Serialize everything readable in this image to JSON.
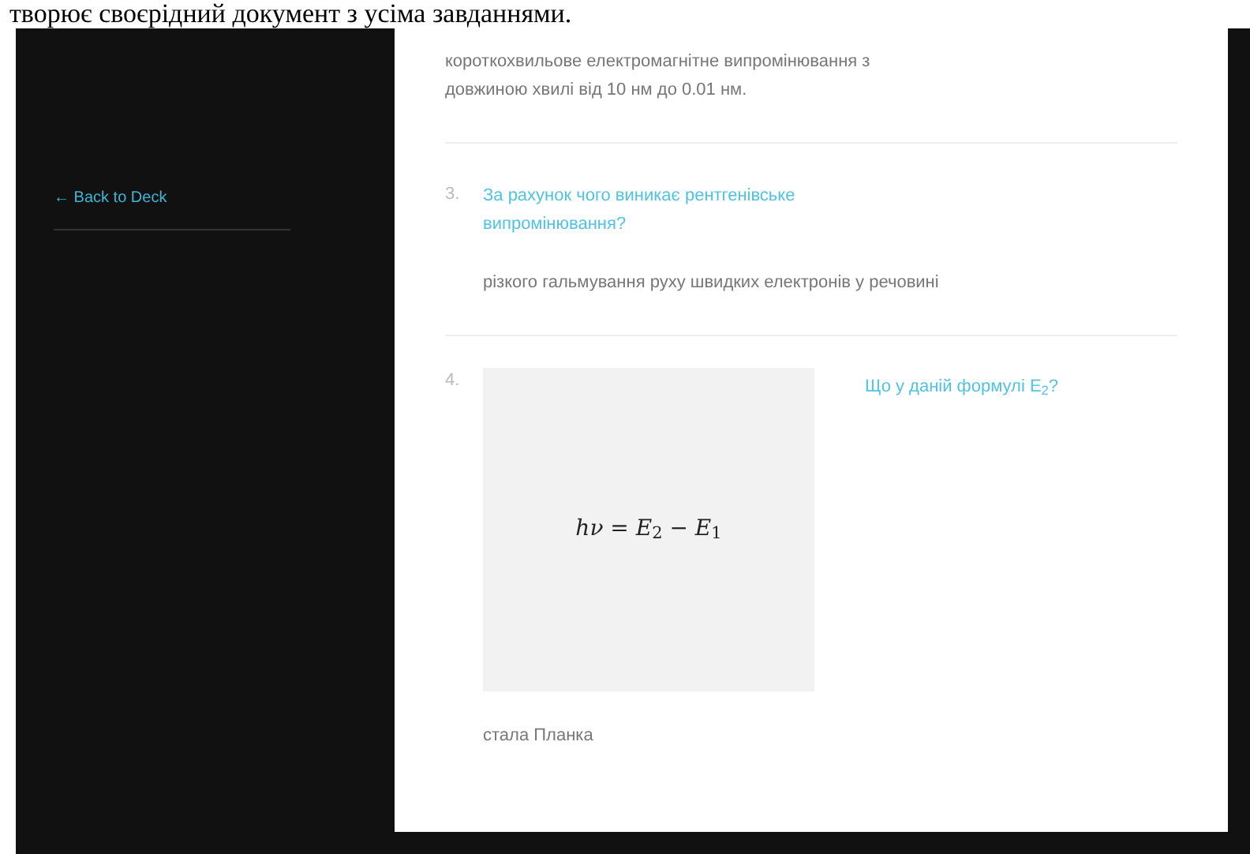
{
  "document_line": "творює своєрідний документ з усіма завданнями.",
  "sidebar": {
    "back_link": "← Back to Deck"
  },
  "cards": [
    {
      "kind": "answer_only",
      "answer": "короткохвильове електромагнітне випромінювання з довжиною хвилі від 10 нм до 0.01 нм."
    },
    {
      "kind": "question",
      "number": "3.",
      "question": "За рахунок чого виникає рентгенівське випромінювання?",
      "answer": "різкого гальмування руху швидких електронів у речовині"
    },
    {
      "kind": "image_question",
      "number": "4.",
      "formula": "*hν* = *E*$_{2}$ − *E*$_{1}$",
      "question": "Що у даній формулі E$_{2}$?",
      "answer": "стала Планка"
    }
  ]
}
